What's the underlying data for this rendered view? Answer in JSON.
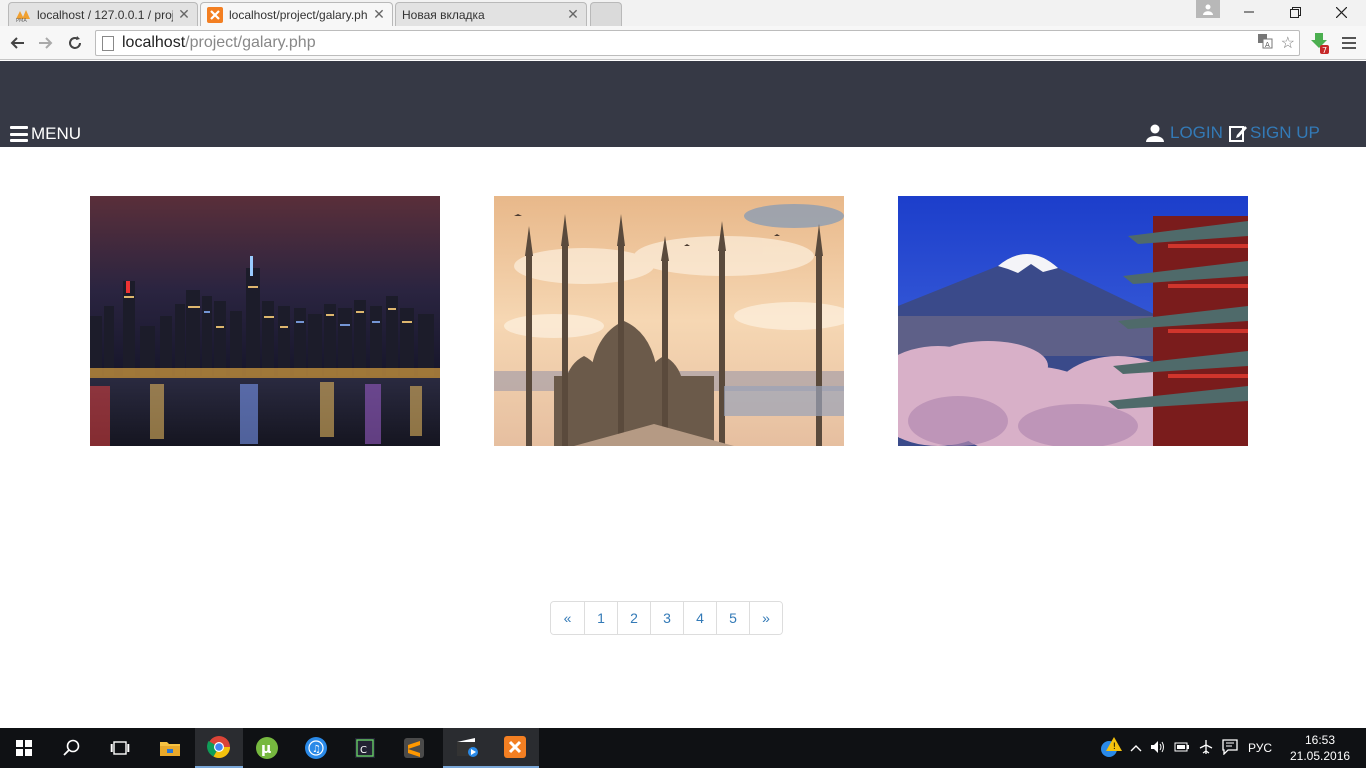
{
  "browser": {
    "tabs": [
      {
        "title": "localhost / 127.0.0.1 / proj",
        "icon": "phpmyadmin-icon",
        "active": false
      },
      {
        "title": "localhost/project/galary.ph",
        "icon": "xampp-icon",
        "active": true
      },
      {
        "title": "Новая вкладка",
        "icon": "",
        "active": false
      }
    ],
    "address": {
      "host": "localhost",
      "path": "/project/galary.php"
    }
  },
  "nav": {
    "menu_label": "MENU",
    "login_label": "LOGIN",
    "signup_label": "SIGN UP"
  },
  "gallery": {
    "images": [
      {
        "subject": "city-night-skyline"
      },
      {
        "subject": "mosque-minarets-sunset"
      },
      {
        "subject": "mount-fuji-pagoda-blossoms"
      }
    ]
  },
  "pagination": {
    "prev": "«",
    "pages": [
      "1",
      "2",
      "3",
      "4",
      "5"
    ],
    "next": "»"
  },
  "taskbar": {
    "language": "РУС",
    "time": "16:53",
    "date": "21.05.2016"
  },
  "colors": {
    "header_bg": "#363945",
    "link": "#337ab7",
    "taskbar_bg": "#0f1114"
  }
}
